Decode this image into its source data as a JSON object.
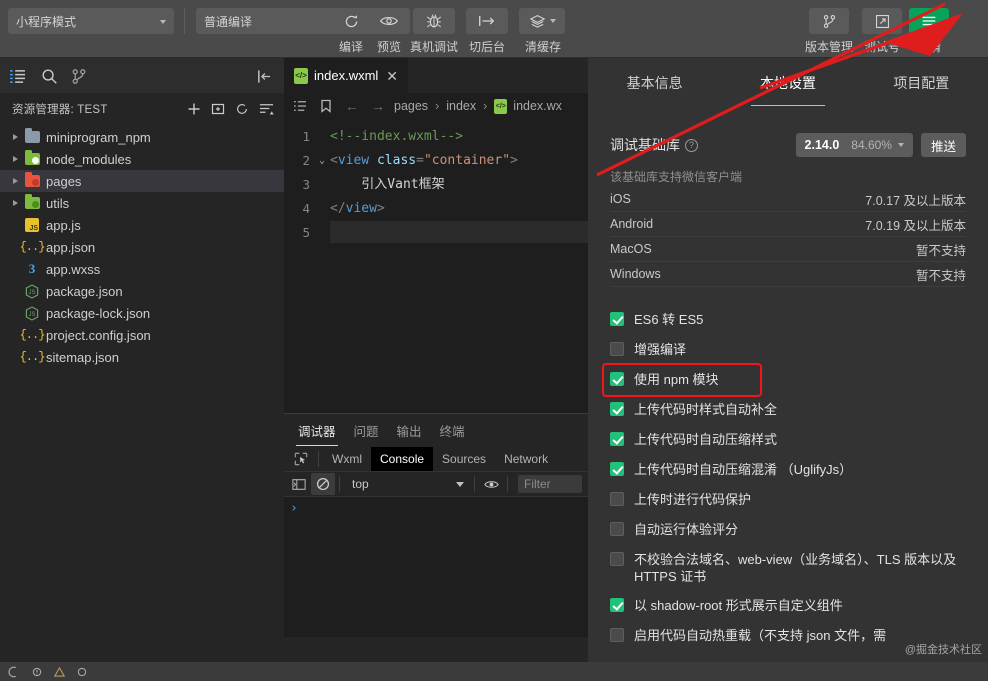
{
  "toolbar": {
    "mode_select": "小程序模式",
    "compile_select": "普通编译",
    "actions": [
      {
        "label": "编译",
        "icon": "refresh-icon"
      },
      {
        "label": "预览",
        "icon": "eye-icon"
      },
      {
        "label": "真机调试",
        "icon": "bug-icon"
      },
      {
        "label": "切后台",
        "icon": "send-to-back-icon"
      },
      {
        "label": "清缓存",
        "icon": "layers-icon"
      }
    ],
    "right_actions": [
      {
        "label": "版本管理",
        "icon": "git-branch-icon"
      },
      {
        "label": "测试号",
        "icon": "external-link-icon"
      },
      {
        "label": "详情",
        "icon": "hamburger-icon"
      }
    ],
    "accent_green": "#07a35a"
  },
  "activity_bar": {
    "items": [
      {
        "name": "explorer",
        "icon": "files-icon"
      },
      {
        "name": "search",
        "icon": "search-icon"
      },
      {
        "name": "scm",
        "icon": "source-control-icon"
      }
    ],
    "collapse_icon": "collapse-panel-icon"
  },
  "explorer": {
    "title": "资源管理器: TEST",
    "actions": [
      {
        "name": "new-file",
        "icon": "plus-icon"
      },
      {
        "name": "new-folder",
        "icon": "new-folder-icon"
      },
      {
        "name": "refresh",
        "icon": "refresh-icon"
      },
      {
        "name": "collapse-all",
        "icon": "collapse-all-icon"
      }
    ],
    "files": [
      {
        "name": "miniprogram_npm",
        "type": "folder",
        "color": "#8a9aa8",
        "expandable": true,
        "selected": false
      },
      {
        "name": "node_modules",
        "type": "folder",
        "color": "#7fb93d",
        "expandable": true,
        "selected": false,
        "badge": "#ffffff"
      },
      {
        "name": "pages",
        "type": "folder",
        "color": "#e8543f",
        "expandable": true,
        "selected": true,
        "badge": "#c13b29"
      },
      {
        "name": "utils",
        "type": "folder",
        "color": "#7fb93d",
        "expandable": true,
        "selected": false,
        "badge": "#4a8f1c"
      },
      {
        "name": "app.js",
        "type": "js",
        "expandable": false,
        "selected": false
      },
      {
        "name": "app.json",
        "type": "json",
        "expandable": false,
        "selected": false
      },
      {
        "name": "app.wxss",
        "type": "wxss",
        "expandable": false,
        "selected": false
      },
      {
        "name": "package.json",
        "type": "node",
        "expandable": false,
        "selected": false
      },
      {
        "name": "package-lock.json",
        "type": "node",
        "expandable": false,
        "selected": false
      },
      {
        "name": "project.config.json",
        "type": "json",
        "expandable": false,
        "selected": false
      },
      {
        "name": "sitemap.json",
        "type": "json",
        "expandable": false,
        "selected": false
      }
    ]
  },
  "editor": {
    "tab": {
      "label": "index.wxml",
      "close": "✕",
      "icon": "wxml-file-icon"
    },
    "breadcrumb": {
      "outline_icon": "outline-icon",
      "bookmark_icon": "bookmark-icon",
      "back_icon": "←",
      "forward_icon": "→",
      "items": [
        "pages",
        "index",
        "index.wx"
      ],
      "separator": "›"
    },
    "lines": [
      {
        "n": "1",
        "fold": "",
        "html": "<span class='k-com'>&lt;!--index.wxml--&gt;</span>"
      },
      {
        "n": "2",
        "fold": "⌄",
        "html": "<span class='k-punc'>&lt;</span><span class='k-tag'>view</span> <span class='k-attr'>class</span><span class='k-punc'>=</span><span class='k-str'>\"container\"</span><span class='k-punc'>&gt;</span>"
      },
      {
        "n": "3",
        "fold": "",
        "html": "<span class='k-txt'>    引入Vant框架</span>"
      },
      {
        "n": "4",
        "fold": "",
        "html": "<span class='k-punc'>&lt;/</span><span class='k-tag'>view</span><span class='k-punc'>&gt;</span>"
      },
      {
        "n": "5",
        "fold": "",
        "html": ""
      }
    ]
  },
  "devpanel": {
    "tabs": [
      {
        "label": "调试器",
        "active": true
      },
      {
        "label": "问题",
        "active": false
      },
      {
        "label": "输出",
        "active": false
      },
      {
        "label": "终端",
        "active": false
      }
    ],
    "devtools_tabs": [
      {
        "label": "Wxml",
        "active": false
      },
      {
        "label": "Console",
        "active": true
      },
      {
        "label": "Sources",
        "active": false
      },
      {
        "label": "Network",
        "active": false
      }
    ],
    "inspect_icon": "inspect-element-icon",
    "console": {
      "sidebar_icon": "console-sidebar-icon",
      "clear_icon": "clear-console-icon",
      "context": "top",
      "eye_icon": "live-expression-icon",
      "filter_placeholder": "Filter",
      "prompt": "›"
    }
  },
  "detail": {
    "tabs": [
      {
        "label": "基本信息",
        "active": false
      },
      {
        "label": "本地设置",
        "active": true
      },
      {
        "label": "项目配置",
        "active": false
      }
    ],
    "base_library": {
      "label": "调试基础库",
      "help_icon": "?",
      "version": "2.14.0",
      "coverage": "84.60%",
      "push_label": "推送"
    },
    "support": {
      "note": "该基础库支持微信客户端",
      "rows": [
        {
          "platform": "iOS",
          "value": "7.0.17 及以上版本"
        },
        {
          "platform": "Android",
          "value": "7.0.19 及以上版本"
        },
        {
          "platform": "MacOS",
          "value": "暂不支持"
        },
        {
          "platform": "Windows",
          "value": "暂不支持"
        }
      ]
    },
    "settings": [
      {
        "label": "ES6 转 ES5",
        "checked": true,
        "highlighted": false
      },
      {
        "label": "增强编译",
        "checked": false,
        "highlighted": false
      },
      {
        "label": "使用 npm 模块",
        "checked": true,
        "highlighted": true
      },
      {
        "label": "上传代码时样式自动补全",
        "checked": true,
        "highlighted": false
      },
      {
        "label": "上传代码时自动压缩样式",
        "checked": true,
        "highlighted": false
      },
      {
        "label": "上传代码时自动压缩混淆 （UglifyJs）",
        "checked": true,
        "highlighted": false
      },
      {
        "label": "上传时进行代码保护",
        "checked": false,
        "highlighted": false
      },
      {
        "label": "自动运行体验评分",
        "checked": false,
        "highlighted": false
      },
      {
        "label": "不校验合法域名、web-view（业务域名）、TLS 版本以及 HTTPS 证书",
        "checked": false,
        "highlighted": false
      },
      {
        "label": "以 shadow-root 形式展示自定义组件",
        "checked": true,
        "highlighted": false
      },
      {
        "label": "启用代码自动热重载（不支持 json 文件，需",
        "checked": false,
        "highlighted": false
      }
    ],
    "highlight_color": "#f4141a",
    "check_color": "#21c17a"
  },
  "watermark": "@掘金技术社区",
  "annotation": {
    "color": "#e01d1d",
    "type": "arrow"
  }
}
